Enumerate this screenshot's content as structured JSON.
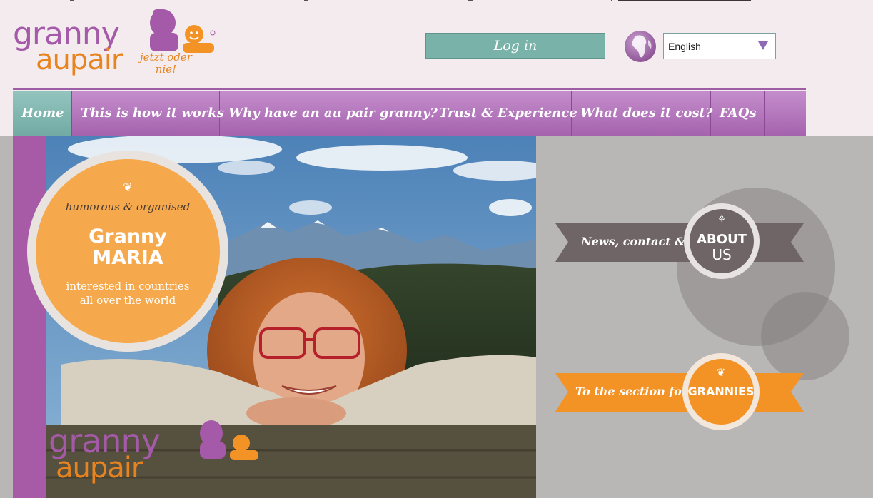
{
  "header": {
    "logo": {
      "word1": "granny",
      "word2": "aupair",
      "tagline_1": "jetzt oder",
      "tagline_2": "nie!"
    },
    "login_label": "Log in",
    "language": {
      "selected": "English"
    }
  },
  "nav": {
    "items": [
      {
        "label": "Home",
        "active": true
      },
      {
        "label": "This is how it works",
        "active": false
      },
      {
        "label": "Why have an au pair granny?",
        "active": false
      },
      {
        "label": "Trust & Experience",
        "active": false
      },
      {
        "label": "What does it cost?",
        "active": false
      },
      {
        "label": "FAQs",
        "active": false
      }
    ]
  },
  "hero": {
    "badge": {
      "line1": "humorous & organised",
      "name_1": "Granny",
      "name_2": "MARIA",
      "desc_1": "interested in countries",
      "desc_2": "all over the world"
    },
    "watermark": {
      "word1": "granny",
      "word2": "aupair"
    }
  },
  "ribbons": {
    "about": {
      "text": "News, contact &",
      "seal_1": "ABOUT",
      "seal_2": "US"
    },
    "grannies": {
      "text": "To the section for",
      "seal_1": "GRANNIES"
    }
  },
  "colors": {
    "purple": "#a75aa6",
    "orange": "#f39325",
    "teal": "#78b2a8",
    "ribbon_gray": "#6f6566"
  }
}
